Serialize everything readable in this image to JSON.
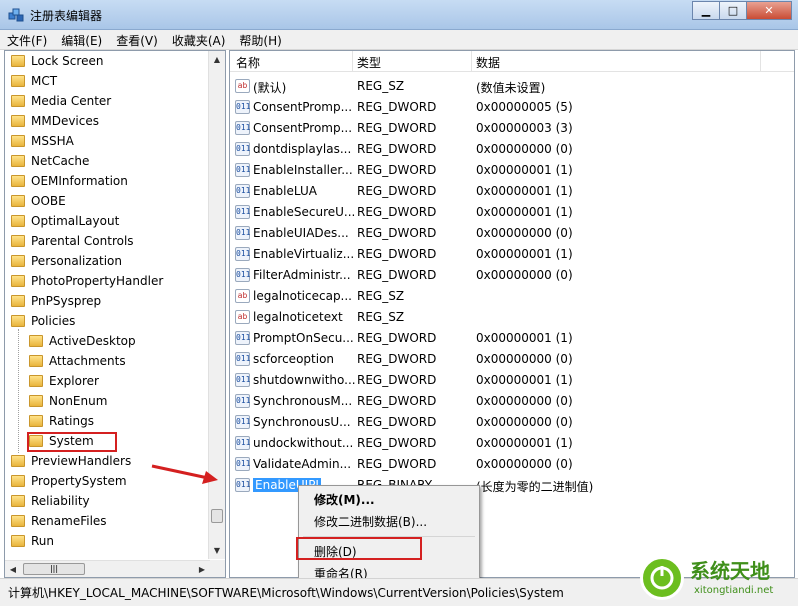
{
  "window": {
    "title": "注册表编辑器",
    "btn_min": "▁",
    "btn_max": "□",
    "btn_close": "✕"
  },
  "menu": [
    {
      "label": "文件(F)"
    },
    {
      "label": "编辑(E)"
    },
    {
      "label": "查看(V)"
    },
    {
      "label": "收藏夹(A)"
    },
    {
      "label": "帮助(H)"
    }
  ],
  "tree": {
    "items": [
      {
        "label": "Lock Screen",
        "level": 0
      },
      {
        "label": "MCT",
        "level": 0
      },
      {
        "label": "Media Center",
        "level": 0
      },
      {
        "label": "MMDevices",
        "level": 0
      },
      {
        "label": "MSSHA",
        "level": 0
      },
      {
        "label": "NetCache",
        "level": 0
      },
      {
        "label": "OEMInformation",
        "level": 0
      },
      {
        "label": "OOBE",
        "level": 0
      },
      {
        "label": "OptimalLayout",
        "level": 0
      },
      {
        "label": "Parental Controls",
        "level": 0
      },
      {
        "label": "Personalization",
        "level": 0
      },
      {
        "label": "PhotoPropertyHandler",
        "level": 0
      },
      {
        "label": "PnPSysprep",
        "level": 0
      },
      {
        "label": "Policies",
        "level": 0
      },
      {
        "label": "ActiveDesktop",
        "level": 1
      },
      {
        "label": "Attachments",
        "level": 1
      },
      {
        "label": "Explorer",
        "level": 1
      },
      {
        "label": "NonEnum",
        "level": 1
      },
      {
        "label": "Ratings",
        "level": 1
      },
      {
        "label": "System",
        "level": 1
      },
      {
        "label": "PreviewHandlers",
        "level": 0
      },
      {
        "label": "PropertySystem",
        "level": 0
      },
      {
        "label": "Reliability",
        "level": 0
      },
      {
        "label": "RenameFiles",
        "level": 0
      },
      {
        "label": "Run",
        "level": 0
      }
    ],
    "hscroll_thumb": "|||"
  },
  "columns": {
    "name": "名称",
    "type": "类型",
    "data": "数据"
  },
  "values": [
    {
      "icon": "ab",
      "name": "(默认)",
      "type": "REG_SZ",
      "data": "(数值未设置)"
    },
    {
      "icon": "011",
      "name": "ConsentPromp...",
      "type": "REG_DWORD",
      "data": "0x00000005 (5)"
    },
    {
      "icon": "011",
      "name": "ConsentPromp...",
      "type": "REG_DWORD",
      "data": "0x00000003 (3)"
    },
    {
      "icon": "011",
      "name": "dontdisplaylas...",
      "type": "REG_DWORD",
      "data": "0x00000000 (0)"
    },
    {
      "icon": "011",
      "name": "EnableInstaller...",
      "type": "REG_DWORD",
      "data": "0x00000001 (1)"
    },
    {
      "icon": "011",
      "name": "EnableLUA",
      "type": "REG_DWORD",
      "data": "0x00000001 (1)"
    },
    {
      "icon": "011",
      "name": "EnableSecureU...",
      "type": "REG_DWORD",
      "data": "0x00000001 (1)"
    },
    {
      "icon": "011",
      "name": "EnableUIADes...",
      "type": "REG_DWORD",
      "data": "0x00000000 (0)"
    },
    {
      "icon": "011",
      "name": "EnableVirtualiz...",
      "type": "REG_DWORD",
      "data": "0x00000001 (1)"
    },
    {
      "icon": "011",
      "name": "FilterAdministr...",
      "type": "REG_DWORD",
      "data": "0x00000000 (0)"
    },
    {
      "icon": "ab",
      "name": "legalnoticecap...",
      "type": "REG_SZ",
      "data": ""
    },
    {
      "icon": "ab",
      "name": "legalnoticetext",
      "type": "REG_SZ",
      "data": ""
    },
    {
      "icon": "011",
      "name": "PromptOnSecu...",
      "type": "REG_DWORD",
      "data": "0x00000001 (1)"
    },
    {
      "icon": "011",
      "name": "scforceoption",
      "type": "REG_DWORD",
      "data": "0x00000000 (0)"
    },
    {
      "icon": "011",
      "name": "shutdownwitho...",
      "type": "REG_DWORD",
      "data": "0x00000001 (1)"
    },
    {
      "icon": "011",
      "name": "SynchronousM...",
      "type": "REG_DWORD",
      "data": "0x00000000 (0)"
    },
    {
      "icon": "011",
      "name": "SynchronousU...",
      "type": "REG_DWORD",
      "data": "0x00000000 (0)"
    },
    {
      "icon": "011",
      "name": "undockwithout...",
      "type": "REG_DWORD",
      "data": "0x00000001 (1)"
    },
    {
      "icon": "011",
      "name": "ValidateAdmin...",
      "type": "REG_DWORD",
      "data": "0x00000000 (0)"
    },
    {
      "icon": "011",
      "name": "EnableUIPI",
      "type": "REG_BINARY",
      "data": "(长度为零的二进制值)",
      "selected": true
    }
  ],
  "context_menu": {
    "modify": "修改(M)...",
    "modify_binary": "修改二进制数据(B)...",
    "delete": "删除(D)",
    "rename": "重命名(R)"
  },
  "status": {
    "path": "计算机\\HKEY_LOCAL_MACHINE\\SOFTWARE\\Microsoft\\Windows\\CurrentVersion\\Policies\\System"
  },
  "watermark": {
    "title": "系统天地",
    "url": "xitongtiandi.net"
  },
  "colors": {
    "selection": "#3399ff",
    "annotation": "#d42020"
  }
}
